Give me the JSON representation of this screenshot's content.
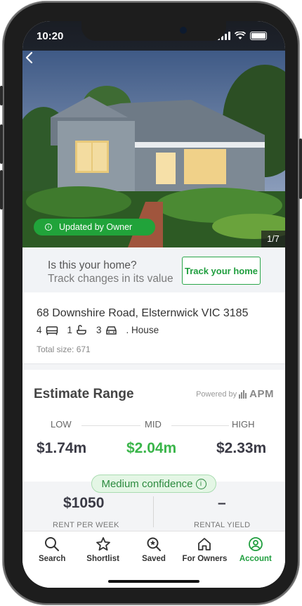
{
  "status_bar": {
    "time": "10:20"
  },
  "hero": {
    "updated_label": "Updated by Owner",
    "counter": "1/7"
  },
  "track": {
    "line1": "Is this your home?",
    "line2": "Track changes in its value",
    "button": "Track your home"
  },
  "property": {
    "address": "68 Downshire Road, Elsternwick VIC 3185",
    "beds": "4",
    "baths": "1",
    "cars": "3",
    "type": ". House",
    "total_size": "Total size: 671"
  },
  "estimate": {
    "title": "Estimate Range",
    "powered_by": "Powered by",
    "provider": "APM",
    "low_label": "LOW",
    "mid_label": "MID",
    "high_label": "HIGH",
    "low": "$1.74m",
    "mid": "$2.04m",
    "high": "$2.33m",
    "confidence": "Medium confidence",
    "rent_value": "$1050",
    "rent_label": "RENT PER WEEK",
    "yield_value": "–",
    "yield_label": "RENTAL YIELD"
  },
  "tabs": [
    {
      "label": "Search",
      "icon": "search-icon",
      "active": false
    },
    {
      "label": "Shortlist",
      "icon": "star-icon",
      "active": false
    },
    {
      "label": "Saved",
      "icon": "saved-search-icon",
      "active": false
    },
    {
      "label": "For Owners",
      "icon": "home-icon",
      "active": false
    },
    {
      "label": "Account",
      "icon": "account-icon",
      "active": true
    }
  ],
  "colors": {
    "brand_green": "#1f9e3e",
    "mid_value": "#3ab54a"
  }
}
